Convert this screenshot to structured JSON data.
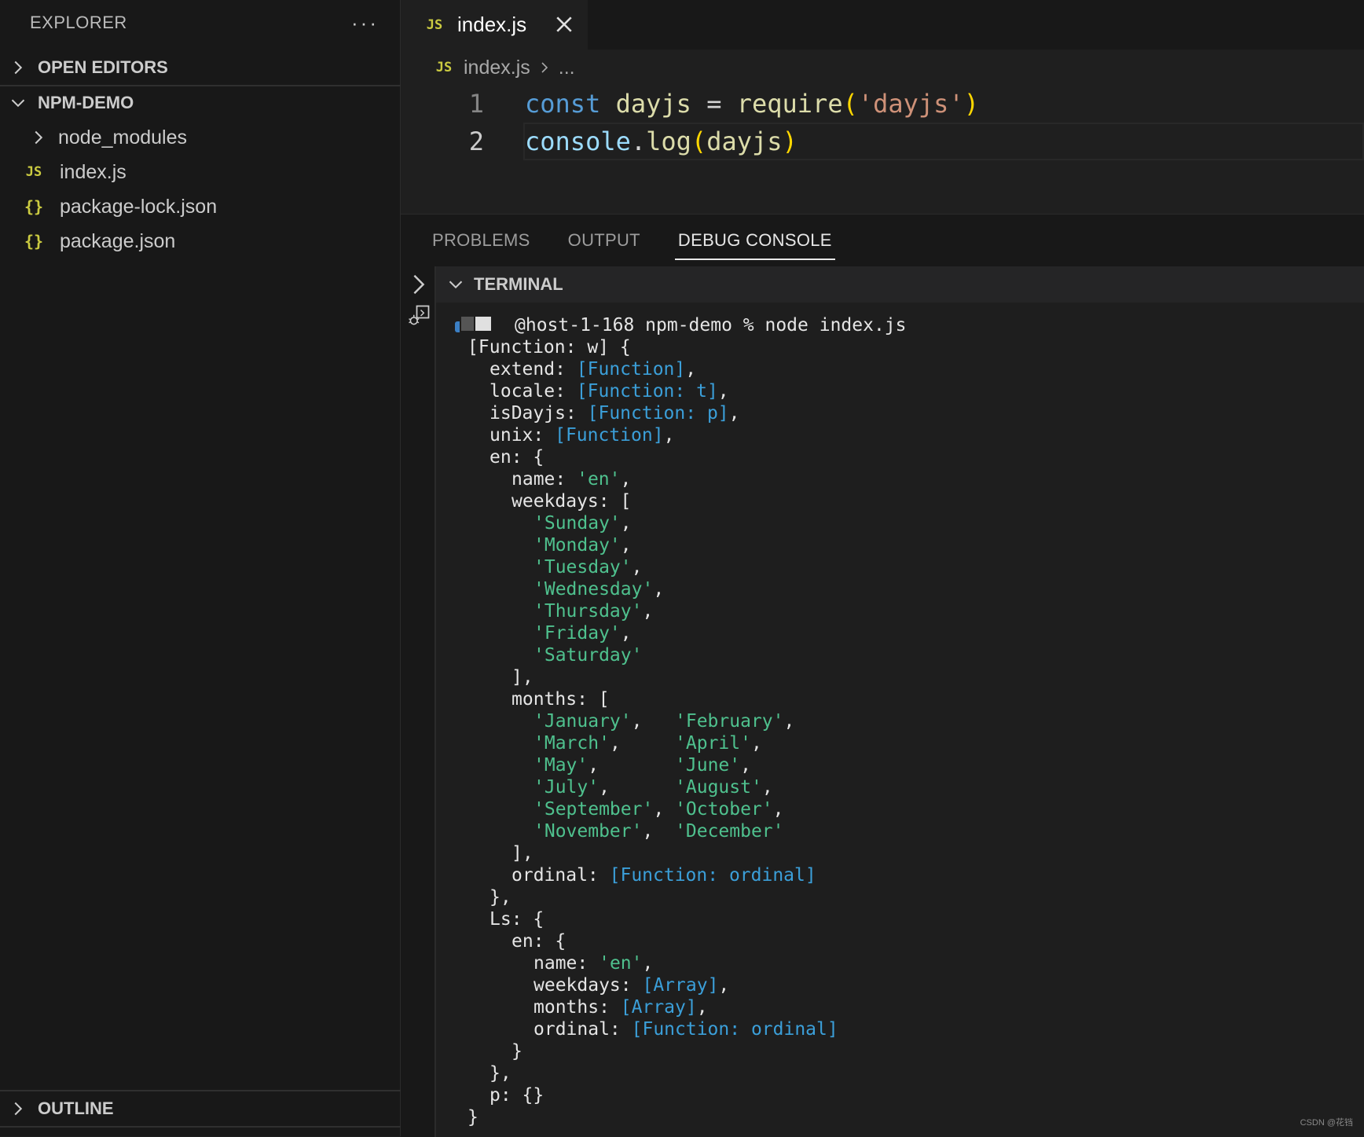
{
  "sidebar": {
    "title": "EXPLORER",
    "more": "···",
    "open_editors": "OPEN EDITORS",
    "project": "NPM-DEMO",
    "items": [
      {
        "label": "node_modules",
        "icon": "chevron-right-icon"
      },
      {
        "label": "index.js",
        "icon": "JS"
      },
      {
        "label": "package-lock.json",
        "icon": "{}"
      },
      {
        "label": "package.json",
        "icon": "{}"
      }
    ],
    "outline": "OUTLINE"
  },
  "editor": {
    "tab_label": "index.js",
    "tab_icon": "JS",
    "breadcrumb_file": "index.js",
    "breadcrumb_more": "...",
    "lines": [
      {
        "no": "1",
        "tokens": [
          {
            "t": "const",
            "c": "kw"
          },
          {
            "t": " ",
            "c": "op"
          },
          {
            "t": "dayjs",
            "c": "var"
          },
          {
            "t": " = ",
            "c": "op"
          },
          {
            "t": "require",
            "c": "fn"
          },
          {
            "t": "(",
            "c": "paren"
          },
          {
            "t": "'dayjs'",
            "c": "str"
          },
          {
            "t": ")",
            "c": "paren"
          }
        ]
      },
      {
        "no": "2",
        "tokens": [
          {
            "t": "console",
            "c": "id"
          },
          {
            "t": ".",
            "c": "op"
          },
          {
            "t": "log",
            "c": "fn"
          },
          {
            "t": "(",
            "c": "paren"
          },
          {
            "t": "dayjs",
            "c": "var"
          },
          {
            "t": ")",
            "c": "paren"
          }
        ]
      }
    ]
  },
  "panel": {
    "tabs": [
      "PROBLEMS",
      "OUTPUT",
      "DEBUG CONSOLE"
    ],
    "active_tab": "DEBUG CONSOLE",
    "terminal_title": "TERMINAL",
    "prompt": "@host-1-168 npm-demo % node index.js",
    "output": [
      {
        "i": 1,
        "s": [
          [
            "[Function: w] {",
            "p"
          ]
        ]
      },
      {
        "i": 2,
        "s": [
          [
            "extend: ",
            "p"
          ],
          [
            "[Function]",
            "f"
          ],
          [
            ",",
            "p"
          ]
        ]
      },
      {
        "i": 2,
        "s": [
          [
            "locale: ",
            "p"
          ],
          [
            "[Function: t]",
            "f"
          ],
          [
            ",",
            "p"
          ]
        ]
      },
      {
        "i": 2,
        "s": [
          [
            "isDayjs: ",
            "p"
          ],
          [
            "[Function: p]",
            "f"
          ],
          [
            ",",
            "p"
          ]
        ]
      },
      {
        "i": 2,
        "s": [
          [
            "unix: ",
            "p"
          ],
          [
            "[Function]",
            "f"
          ],
          [
            ",",
            "p"
          ]
        ]
      },
      {
        "i": 2,
        "s": [
          [
            "en: {",
            "p"
          ]
        ]
      },
      {
        "i": 3,
        "s": [
          [
            "name: ",
            "p"
          ],
          [
            "'en'",
            "s"
          ],
          [
            ",",
            "p"
          ]
        ]
      },
      {
        "i": 3,
        "s": [
          [
            "weekdays: [",
            "p"
          ]
        ]
      },
      {
        "i": 4,
        "s": [
          [
            "'Sunday'",
            "s"
          ],
          [
            ",",
            "p"
          ]
        ]
      },
      {
        "i": 4,
        "s": [
          [
            "'Monday'",
            "s"
          ],
          [
            ",",
            "p"
          ]
        ]
      },
      {
        "i": 4,
        "s": [
          [
            "'Tuesday'",
            "s"
          ],
          [
            ",",
            "p"
          ]
        ]
      },
      {
        "i": 4,
        "s": [
          [
            "'Wednesday'",
            "s"
          ],
          [
            ",",
            "p"
          ]
        ]
      },
      {
        "i": 4,
        "s": [
          [
            "'Thursday'",
            "s"
          ],
          [
            ",",
            "p"
          ]
        ]
      },
      {
        "i": 4,
        "s": [
          [
            "'Friday'",
            "s"
          ],
          [
            ",",
            "p"
          ]
        ]
      },
      {
        "i": 4,
        "s": [
          [
            "'Saturday'",
            "s"
          ]
        ]
      },
      {
        "i": 3,
        "s": [
          [
            "],",
            "p"
          ]
        ]
      },
      {
        "i": 3,
        "s": [
          [
            "months: [",
            "p"
          ]
        ]
      },
      {
        "i": 4,
        "s": [
          [
            "'January'",
            "s"
          ],
          [
            ",   ",
            "p"
          ],
          [
            "'February'",
            "s"
          ],
          [
            ",",
            "p"
          ]
        ]
      },
      {
        "i": 4,
        "s": [
          [
            "'March'",
            "s"
          ],
          [
            ",     ",
            "p"
          ],
          [
            "'April'",
            "s"
          ],
          [
            ",",
            "p"
          ]
        ]
      },
      {
        "i": 4,
        "s": [
          [
            "'May'",
            "s"
          ],
          [
            ",       ",
            "p"
          ],
          [
            "'June'",
            "s"
          ],
          [
            ",",
            "p"
          ]
        ]
      },
      {
        "i": 4,
        "s": [
          [
            "'July'",
            "s"
          ],
          [
            ",      ",
            "p"
          ],
          [
            "'August'",
            "s"
          ],
          [
            ",",
            "p"
          ]
        ]
      },
      {
        "i": 4,
        "s": [
          [
            "'September'",
            "s"
          ],
          [
            ", ",
            "p"
          ],
          [
            "'October'",
            "s"
          ],
          [
            ",",
            "p"
          ]
        ]
      },
      {
        "i": 4,
        "s": [
          [
            "'November'",
            "s"
          ],
          [
            ",  ",
            "p"
          ],
          [
            "'December'",
            "s"
          ]
        ]
      },
      {
        "i": 3,
        "s": [
          [
            "],",
            "p"
          ]
        ]
      },
      {
        "i": 3,
        "s": [
          [
            "ordinal: ",
            "p"
          ],
          [
            "[Function: ordinal]",
            "f"
          ]
        ]
      },
      {
        "i": 2,
        "s": [
          [
            "},",
            "p"
          ]
        ]
      },
      {
        "i": 2,
        "s": [
          [
            "Ls: {",
            "p"
          ]
        ]
      },
      {
        "i": 3,
        "s": [
          [
            "en: {",
            "p"
          ]
        ]
      },
      {
        "i": 4,
        "s": [
          [
            "name: ",
            "p"
          ],
          [
            "'en'",
            "s"
          ],
          [
            ",",
            "p"
          ]
        ]
      },
      {
        "i": 4,
        "s": [
          [
            "weekdays: ",
            "p"
          ],
          [
            "[Array]",
            "f"
          ],
          [
            ",",
            "p"
          ]
        ]
      },
      {
        "i": 4,
        "s": [
          [
            "months: ",
            "p"
          ],
          [
            "[Array]",
            "f"
          ],
          [
            ",",
            "p"
          ]
        ]
      },
      {
        "i": 4,
        "s": [
          [
            "ordinal: ",
            "p"
          ],
          [
            "[Function: ordinal]",
            "f"
          ]
        ]
      },
      {
        "i": 3,
        "s": [
          [
            "}",
            "p"
          ]
        ]
      },
      {
        "i": 2,
        "s": [
          [
            "},",
            "p"
          ]
        ]
      },
      {
        "i": 2,
        "s": [
          [
            "p: {}",
            "p"
          ]
        ]
      },
      {
        "i": 1,
        "s": [
          [
            "}",
            "p"
          ]
        ]
      }
    ]
  },
  "watermark": "CSDN @花铛",
  "colors": {
    "accent_string": "#4fc18e",
    "accent_function": "#3b9fd9",
    "json_icon": "#cbcb41"
  }
}
